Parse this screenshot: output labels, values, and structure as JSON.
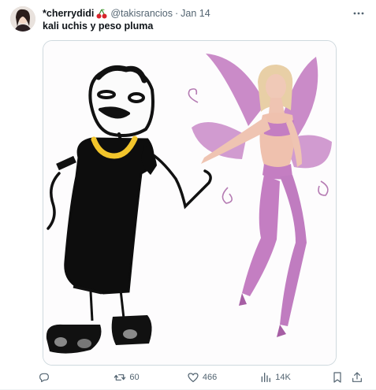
{
  "tweet": {
    "display_name": "*cherrydidi",
    "handle": "@takisrancios",
    "separator": "·",
    "date": "Jan 14",
    "text": "kali uchis y peso pluma"
  },
  "actions": {
    "reply_count": "",
    "retweet_count": "60",
    "like_count": "466",
    "views_count": "14K"
  },
  "icons": {
    "avatar": "avatar",
    "name_emoji": "cherry-icon",
    "more": "more-dots-icon",
    "reply": "reply-icon",
    "retweet": "retweet-icon",
    "like": "heart-icon",
    "views": "views-bar-chart-icon",
    "bookmark": "bookmark-icon",
    "share": "share-icon"
  },
  "colors": {
    "text_primary": "#0f1419",
    "text_secondary": "#536471",
    "border": "#cfd9de",
    "fairy_pink": "#c47ec2"
  }
}
